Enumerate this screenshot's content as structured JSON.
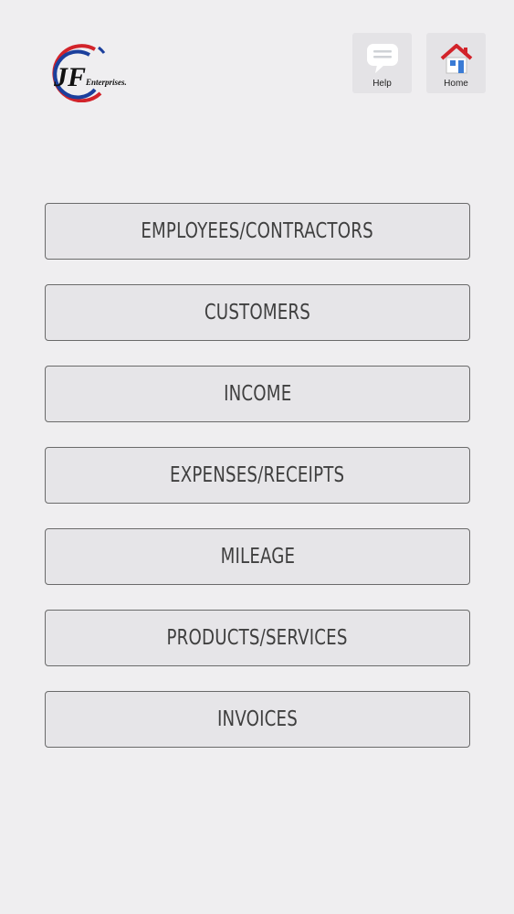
{
  "brand": {
    "logo_text": "JF",
    "logo_subtext": "Enterprises.",
    "colors": {
      "red": "#d2232a",
      "blue": "#1b3f9c",
      "dark": "#111111"
    }
  },
  "header": {
    "help": {
      "label": "Help",
      "icon": "chat-bubble-icon"
    },
    "home": {
      "label": "Home",
      "icon": "house-icon"
    }
  },
  "menu": {
    "items": [
      {
        "label": "EMPLOYEES/CONTRACTORS"
      },
      {
        "label": "CUSTOMERS"
      },
      {
        "label": "INCOME"
      },
      {
        "label": "EXPENSES/RECEIPTS"
      },
      {
        "label": "MILEAGE"
      },
      {
        "label": "PRODUCTS/SERVICES"
      },
      {
        "label": "INVOICES"
      }
    ]
  }
}
